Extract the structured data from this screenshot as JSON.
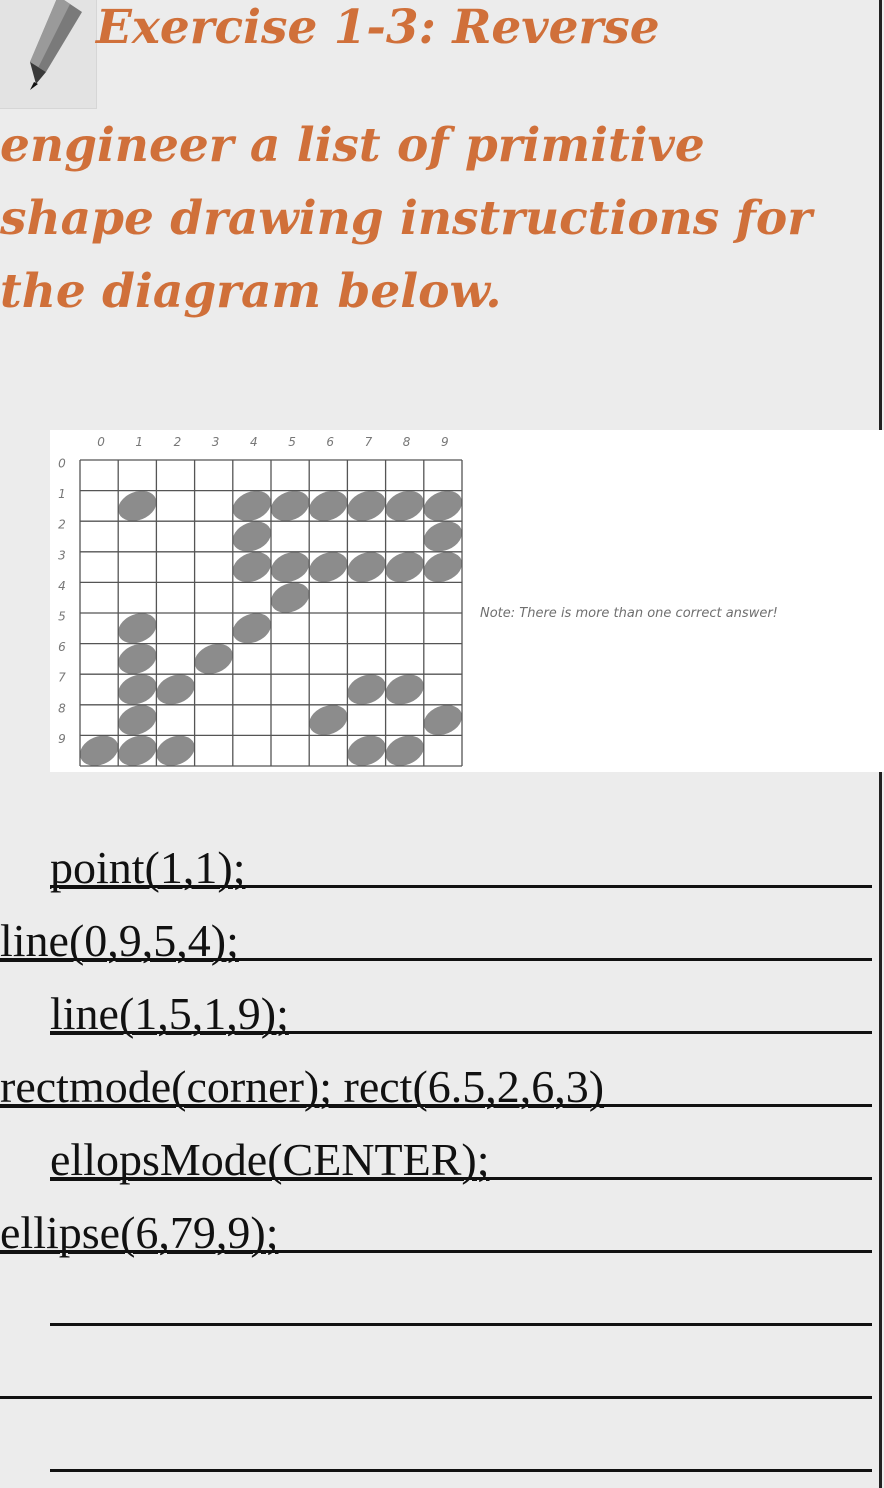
{
  "instruction": {
    "line1": "Exercise 1-3: Reverse",
    "line2": "engineer a list of primitive",
    "line3": "shape drawing instructions for",
    "line4": "the diagram below."
  },
  "diagram": {
    "column_labels": [
      "0",
      "1",
      "2",
      "3",
      "4",
      "5",
      "6",
      "7",
      "8",
      "9"
    ],
    "row_labels": [
      "0",
      "1",
      "2",
      "3",
      "4",
      "5",
      "6",
      "7",
      "8",
      "9"
    ],
    "note": "Note: There is more than one correct answer!"
  },
  "answers": [
    "point(1,1);",
    "line(0,9,5,4);",
    "line(1,5,1,9);",
    "rectmode(corner); rect(6.5,2,6,3)",
    "ellopsMode(CENTER);",
    "ellipse(6,79,9);",
    "",
    "",
    ""
  ]
}
